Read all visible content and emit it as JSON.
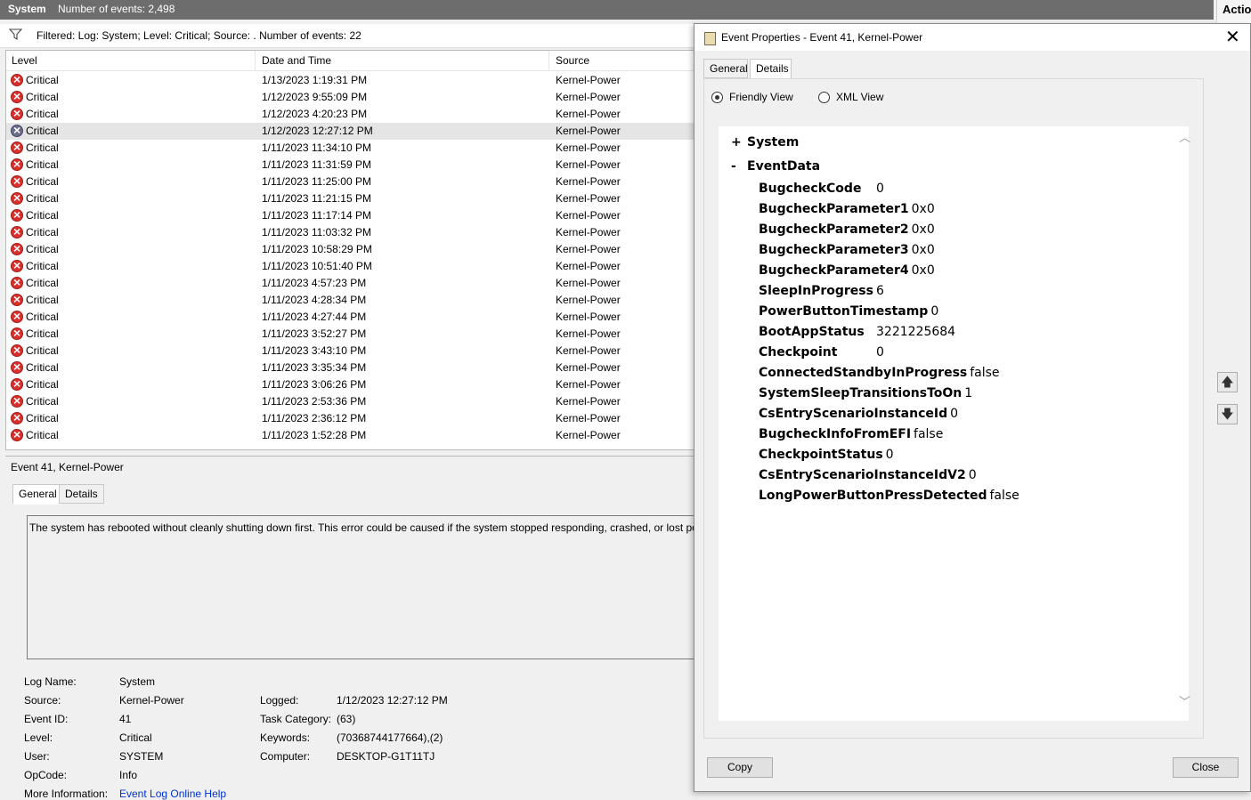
{
  "header": {
    "app_title": "System",
    "event_count": "Number of events: 2,498",
    "actions_tab": "Action"
  },
  "filter": {
    "text": "Filtered: Log: System; Level: Critical; Source: . Number of events: 22"
  },
  "columns": {
    "level": "Level",
    "datetime": "Date and Time",
    "source": "Source"
  },
  "events": [
    {
      "level": "Critical",
      "datetime": "1/13/2023 1:19:31 PM",
      "source": "Kernel-Power"
    },
    {
      "level": "Critical",
      "datetime": "1/12/2023 9:55:09 PM",
      "source": "Kernel-Power"
    },
    {
      "level": "Critical",
      "datetime": "1/12/2023 4:20:23 PM",
      "source": "Kernel-Power"
    },
    {
      "level": "Critical",
      "datetime": "1/12/2023 12:27:12 PM",
      "source": "Kernel-Power",
      "selected": true
    },
    {
      "level": "Critical",
      "datetime": "1/11/2023 11:34:10 PM",
      "source": "Kernel-Power"
    },
    {
      "level": "Critical",
      "datetime": "1/11/2023 11:31:59 PM",
      "source": "Kernel-Power"
    },
    {
      "level": "Critical",
      "datetime": "1/11/2023 11:25:00 PM",
      "source": "Kernel-Power"
    },
    {
      "level": "Critical",
      "datetime": "1/11/2023 11:21:15 PM",
      "source": "Kernel-Power"
    },
    {
      "level": "Critical",
      "datetime": "1/11/2023 11:17:14 PM",
      "source": "Kernel-Power"
    },
    {
      "level": "Critical",
      "datetime": "1/11/2023 11:03:32 PM",
      "source": "Kernel-Power"
    },
    {
      "level": "Critical",
      "datetime": "1/11/2023 10:58:29 PM",
      "source": "Kernel-Power"
    },
    {
      "level": "Critical",
      "datetime": "1/11/2023 10:51:40 PM",
      "source": "Kernel-Power"
    },
    {
      "level": "Critical",
      "datetime": "1/11/2023 4:57:23 PM",
      "source": "Kernel-Power"
    },
    {
      "level": "Critical",
      "datetime": "1/11/2023 4:28:34 PM",
      "source": "Kernel-Power"
    },
    {
      "level": "Critical",
      "datetime": "1/11/2023 4:27:44 PM",
      "source": "Kernel-Power"
    },
    {
      "level": "Critical",
      "datetime": "1/11/2023 3:52:27 PM",
      "source": "Kernel-Power"
    },
    {
      "level": "Critical",
      "datetime": "1/11/2023 3:43:10 PM",
      "source": "Kernel-Power"
    },
    {
      "level": "Critical",
      "datetime": "1/11/2023 3:35:34 PM",
      "source": "Kernel-Power"
    },
    {
      "level": "Critical",
      "datetime": "1/11/2023 3:06:26 PM",
      "source": "Kernel-Power"
    },
    {
      "level": "Critical",
      "datetime": "1/11/2023 2:53:36 PM",
      "source": "Kernel-Power"
    },
    {
      "level": "Critical",
      "datetime": "1/11/2023 2:36:12 PM",
      "source": "Kernel-Power"
    },
    {
      "level": "Critical",
      "datetime": "1/11/2023 1:52:28 PM",
      "source": "Kernel-Power"
    }
  ],
  "detail": {
    "title": "Event 41, Kernel-Power",
    "tabs": [
      "General",
      "Details"
    ],
    "description": "The system has rebooted without cleanly shutting down first. This error could be caused if the system stopped responding, crashed, or lost po",
    "props_left": [
      {
        "label": "Log Name:",
        "value": "System"
      },
      {
        "label": "Source:",
        "value": "Kernel-Power"
      },
      {
        "label": "Event ID:",
        "value": "41"
      },
      {
        "label": "Level:",
        "value": "Critical"
      },
      {
        "label": "User:",
        "value": "SYSTEM"
      },
      {
        "label": "OpCode:",
        "value": "Info"
      },
      {
        "label": "More Information:",
        "value": "Event Log Online Help"
      }
    ],
    "props_right": [
      {
        "label": "Logged:",
        "value": "1/12/2023 12:27:12 PM"
      },
      {
        "label": "Task Category:",
        "value": "(63)"
      },
      {
        "label": "Keywords:",
        "value": "(70368744177664),(2)"
      },
      {
        "label": "Computer:",
        "value": "DESKTOP-G1T11TJ"
      }
    ]
  },
  "dialog": {
    "title": "Event Properties - Event 41, Kernel-Power",
    "tabs": [
      "General",
      "Details"
    ],
    "radio_friendly": "Friendly View",
    "radio_xml": "XML View",
    "tree_system": "System",
    "tree_eventdata": "EventData",
    "tree_system_toggle": "+",
    "tree_eventdata_toggle": "-",
    "fields": [
      {
        "key": "BugcheckCode",
        "value": "0"
      },
      {
        "key": "BugcheckParameter1",
        "value": "0x0"
      },
      {
        "key": "BugcheckParameter2",
        "value": "0x0"
      },
      {
        "key": "BugcheckParameter3",
        "value": "0x0"
      },
      {
        "key": "BugcheckParameter4",
        "value": "0x0"
      },
      {
        "key": "SleepInProgress",
        "value": "6"
      },
      {
        "key": "PowerButtonTimestamp",
        "value": "0"
      },
      {
        "key": "BootAppStatus",
        "value": "3221225684"
      },
      {
        "key": "Checkpoint",
        "value": "0"
      },
      {
        "key": "ConnectedStandbyInProgress",
        "value": "false"
      },
      {
        "key": "SystemSleepTransitionsToOn",
        "value": "1"
      },
      {
        "key": "CsEntryScenarioInstanceId",
        "value": "0"
      },
      {
        "key": "BugcheckInfoFromEFI",
        "value": "false"
      },
      {
        "key": "CheckpointStatus",
        "value": "0"
      },
      {
        "key": "CsEntryScenarioInstanceIdV2",
        "value": "0"
      },
      {
        "key": "LongPowerButtonPressDetected",
        "value": "false"
      }
    ],
    "copy_label": "Copy",
    "close_label": "Close"
  }
}
